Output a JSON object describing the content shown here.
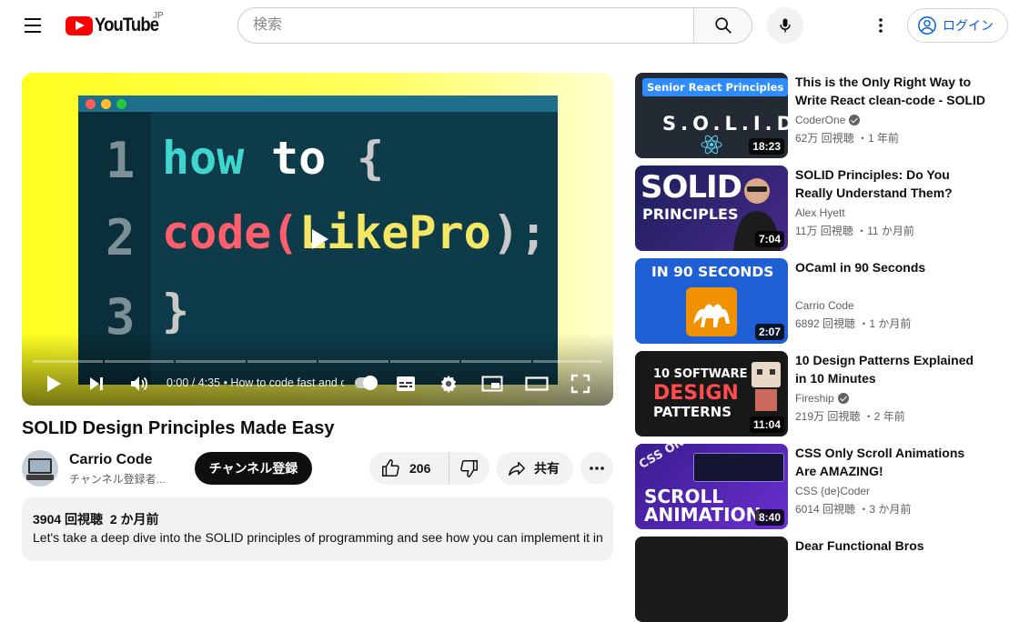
{
  "header": {
    "logo_text": "YouTube",
    "region": "JP",
    "search_placeholder": "検索",
    "login_label": "ログイン"
  },
  "player": {
    "code_lines": [
      "1",
      "2",
      "3"
    ],
    "code_line1_a": "how",
    "code_line1_b": "to",
    "code_line1_c": "{",
    "code_line2_a": "code(",
    "code_line2_b": "LikePro",
    "code_line2_c": ");",
    "code_line3": "}",
    "time": "0:00 / 4:35",
    "chapter": "How to code fast and clean"
  },
  "video": {
    "title": "SOLID Design Principles Made Easy",
    "channel": "Carrio Code",
    "subscribers": "チャンネル登録者...",
    "subscribe_label": "チャンネル登録",
    "likes": "206",
    "share_label": "共有",
    "views": "3904 回視聴",
    "age": "2 か月前",
    "description": "Let's take a deep dive into the SOLID principles of programming and see how you can implement it in"
  },
  "recommendations": [
    {
      "title": "This is the Only Right Way to Write React clean-code - SOLID",
      "channel": "CoderOne",
      "verified": true,
      "meta": "62万 回視聴 ・1 年前",
      "duration": "18:23",
      "thumb_text": [
        "Senior React Principles",
        "S.O.L.I.D"
      ]
    },
    {
      "title": "SOLID Principles: Do You Really Understand Them?",
      "channel": "Alex Hyett",
      "verified": false,
      "meta": "11万 回視聴 ・11 か月前",
      "duration": "7:04",
      "thumb_text": [
        "SOLID",
        "PRINCIPLES"
      ]
    },
    {
      "title": "OCaml in 90 Seconds",
      "channel": "Carrio Code",
      "verified": false,
      "meta": "6892 回視聴 ・1 か月前",
      "duration": "2:07",
      "thumb_text": [
        "IN 90 SECONDS"
      ]
    },
    {
      "title": "10 Design Patterns Explained in 10 Minutes",
      "channel": "Fireship",
      "verified": true,
      "meta": "219万 回視聴 ・2 年前",
      "duration": "11:04",
      "thumb_text": [
        "10 SOFTWARE",
        "DESIGN",
        "PATTERNS"
      ]
    },
    {
      "title": "CSS Only Scroll Animations Are AMAZING!",
      "channel": "CSS {de}Coder",
      "verified": false,
      "meta": "6014 回視聴 ・3 か月前",
      "duration": "8:40",
      "thumb_text": [
        "CSS ONLY!",
        "SCROLL",
        "ANIMATION"
      ]
    },
    {
      "title": "Dear Functional Bros",
      "channel": "",
      "verified": false,
      "meta": "",
      "duration": "",
      "thumb_text": []
    }
  ],
  "colors": {
    "accent": "#ff0000",
    "link": "#065fd4"
  }
}
